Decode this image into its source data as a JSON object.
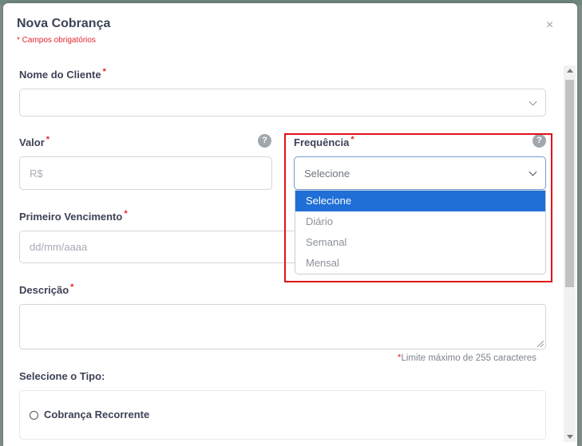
{
  "modal": {
    "title": "Nova Cobrança",
    "subtitle": "* Campos obrigatórios",
    "close_glyph": "×"
  },
  "form": {
    "cliente": {
      "label": "Nome do Cliente",
      "required": "*",
      "value": ""
    },
    "valor": {
      "label": "Valor",
      "required": "*",
      "placeholder": "R$",
      "help": "?"
    },
    "frequencia": {
      "label": "Frequência",
      "required": "*",
      "selected": "Selecione",
      "help": "?",
      "options": [
        "Selecione",
        "Diário",
        "Semanal",
        "Mensal"
      ]
    },
    "vencimento": {
      "label": "Primeiro Vencimento",
      "required": "*",
      "placeholder": "dd/mm/aaaa"
    },
    "descricao": {
      "label": "Descrição",
      "required": "*",
      "limit_star": "*",
      "limit_note": "Limite máximo de 255 caracteres"
    },
    "tipo": {
      "label": "Selecione o Tipo:",
      "options": [
        "Cobrança Recorrente"
      ]
    }
  },
  "colors": {
    "accent": "#1f6fd6",
    "required": "#e3262e",
    "highlight": "#e0111b"
  },
  "icons": [
    "close-icon",
    "chevron-down-icon",
    "help-icon",
    "radio-icon"
  ]
}
